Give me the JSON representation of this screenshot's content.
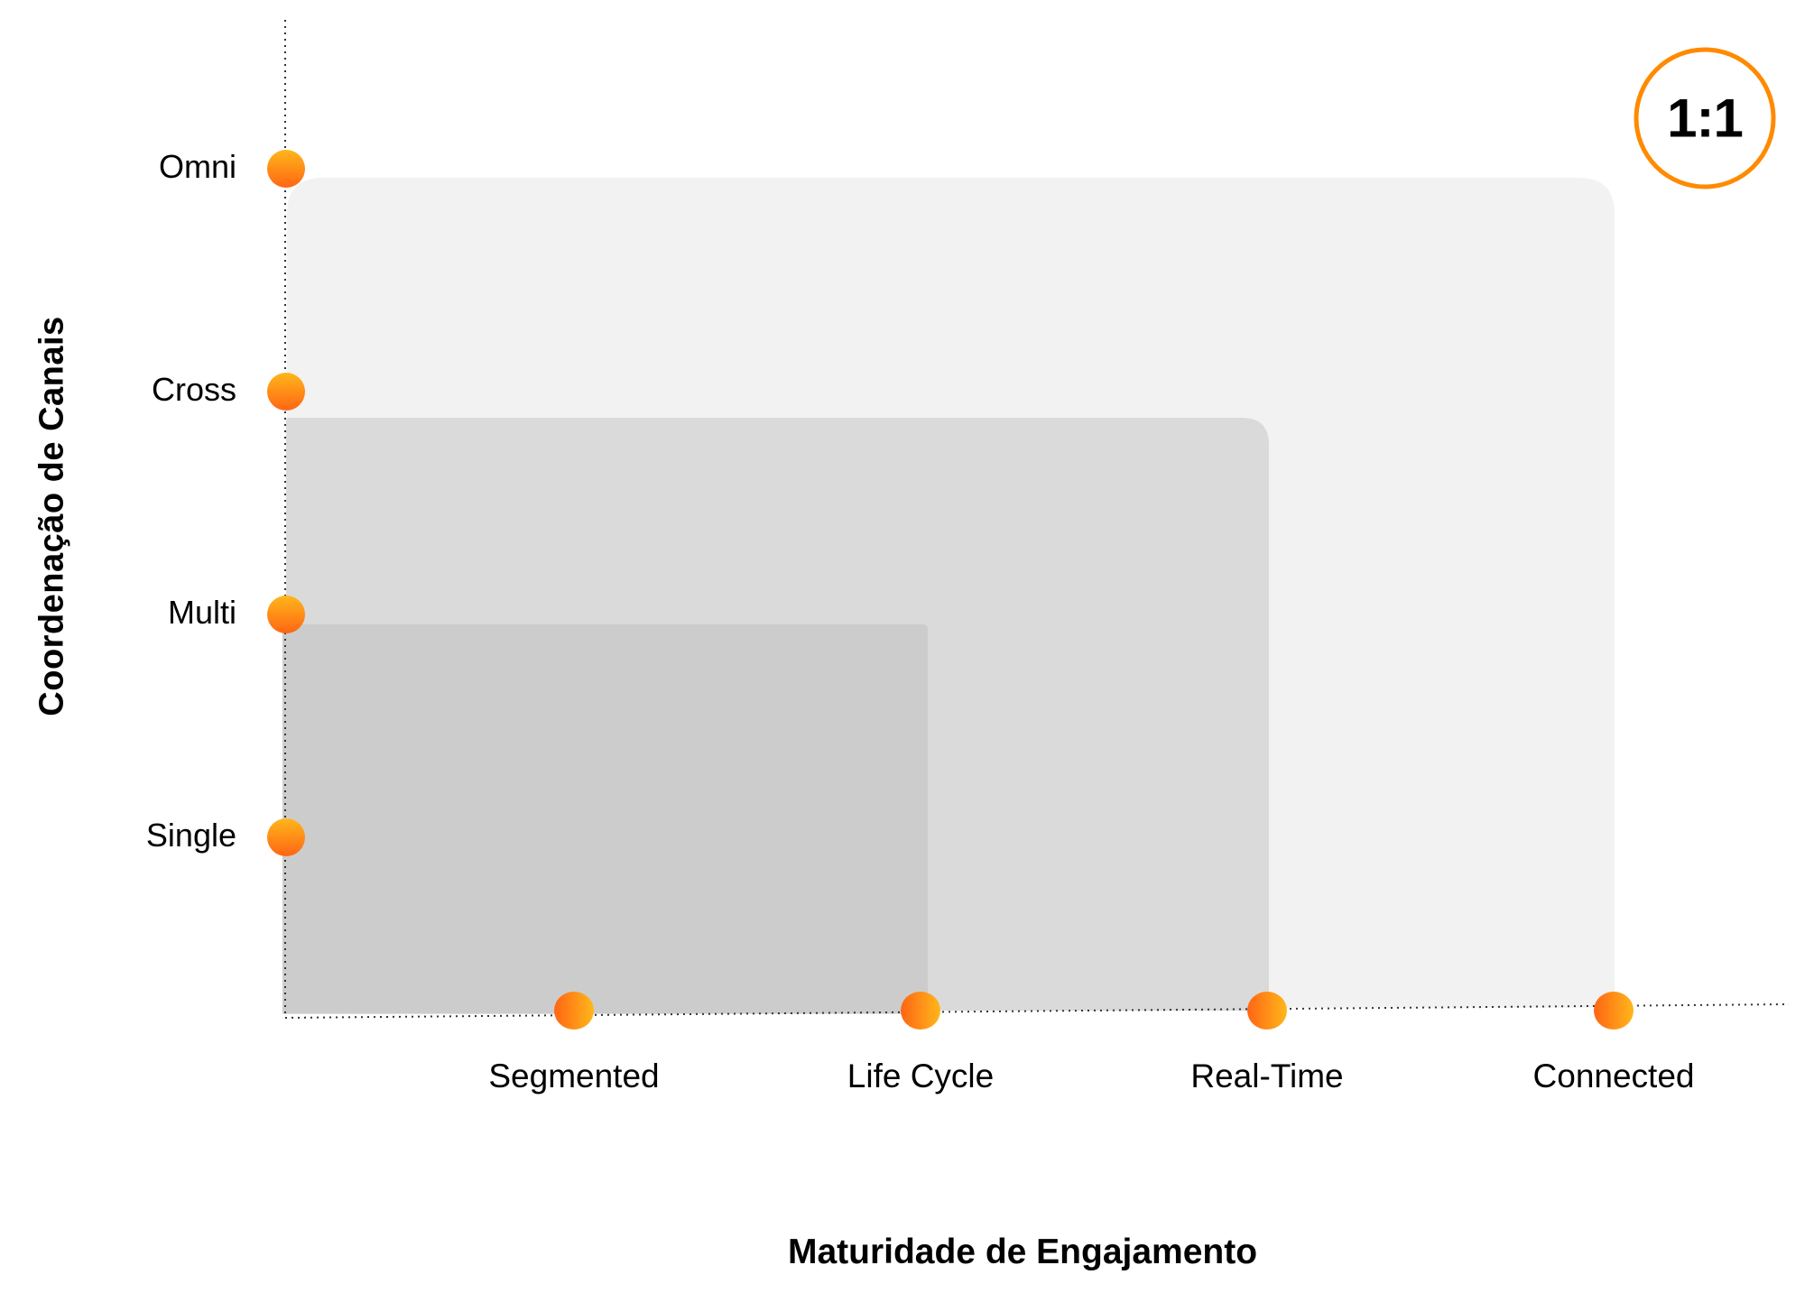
{
  "chart_data": {
    "type": "diagram",
    "title": "",
    "xlabel": "Maturidade de Engajamento",
    "ylabel": "Coordenação de Canais",
    "x_levels": [
      "Segmented",
      "Life Cycle",
      "Real-Time",
      "Connected"
    ],
    "y_levels": [
      "Single",
      "Multi",
      "Cross",
      "Omni"
    ],
    "regions": [
      {
        "name": "outer",
        "x_extent": "Connected",
        "y_extent": "Between Cross and Omni",
        "color": "#F2F2F2"
      },
      {
        "name": "middle",
        "x_extent": "Real-Time",
        "y_extent": "Between Multi and Cross",
        "color": "#DADADA"
      },
      {
        "name": "inner",
        "x_extent": "Life Cycle",
        "y_extent": "Between Single and Multi",
        "color": "#CCCCCC"
      }
    ],
    "badge": "1:1",
    "grid": false,
    "legend": "none"
  },
  "colors": {
    "accent": "#FF8A00",
    "marker_light": "#FFB71B",
    "marker_dark": "#FF6513",
    "region_outer": "#F2F2F2",
    "region_middle": "#DADADA",
    "region_inner": "#CCCCCC",
    "axis": "#333333"
  }
}
